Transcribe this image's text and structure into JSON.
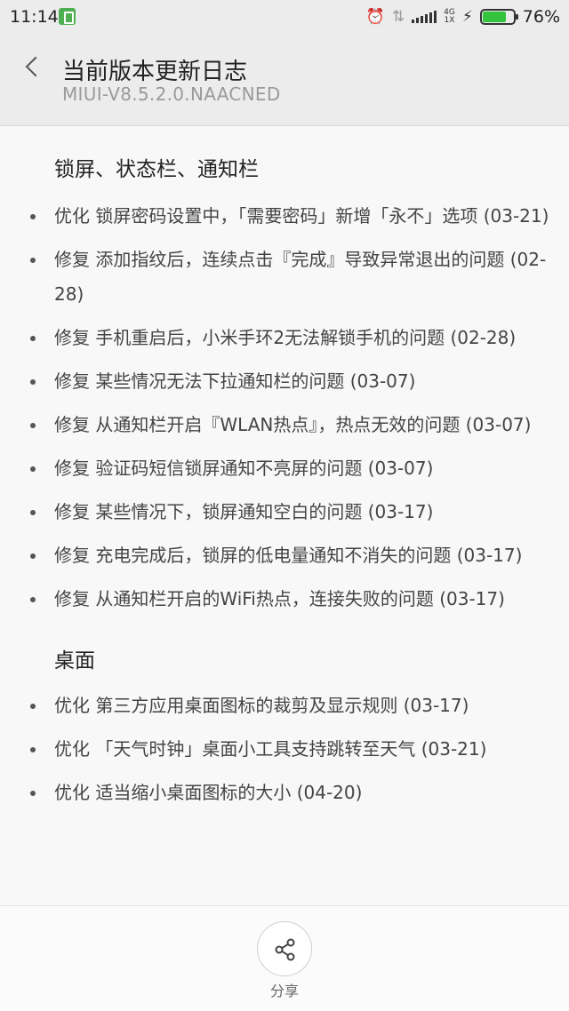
{
  "status_bar": {
    "time": "11:14",
    "network": "4G\n1X",
    "battery_percent": "76%",
    "battery_level": 0.76,
    "icons": [
      "app-battery-icon",
      "alarm-icon",
      "signal-icon",
      "network-4g-icon",
      "charging-icon",
      "battery-icon"
    ]
  },
  "header": {
    "title": "当前版本更新日志",
    "subtitle": "MIUI-V8.5.2.0.NAACNED",
    "back_icon": "chevron-left-icon"
  },
  "sections": [
    {
      "title": "锁屏、状态栏、通知栏",
      "items": [
        "优化 锁屏密码设置中，「需要密码」新增「永不」选项 (03-21)",
        "修复 添加指纹后，连续点击『完成』导致异常退出的问题 (02-28)",
        "修复 手机重启后，小米手环2无法解锁手机的问题 (02-28)",
        "修复 某些情况无法下拉通知栏的问题 (03-07)",
        "修复 从通知栏开启『WLAN热点』，热点无效的问题 (03-07)",
        "修复 验证码短信锁屏通知不亮屏的问题 (03-07)",
        "修复 某些情况下，锁屏通知空白的问题 (03-17)",
        "修复 充电完成后，锁屏的低电量通知不消失的问题 (03-17)",
        "修复 从通知栏开启的WiFi热点，连接失败的问题 (03-17)"
      ]
    },
    {
      "title": "桌面",
      "items": [
        "优化 第三方应用桌面图标的裁剪及显示规则 (03-17)",
        "优化 「天气时钟」桌面小工具支持跳转至天气 (03-21)",
        "优化 适当缩小桌面图标的大小 (04-20)"
      ]
    }
  ],
  "bottom_bar": {
    "share_label": "分享",
    "share_icon": "share-icon"
  }
}
